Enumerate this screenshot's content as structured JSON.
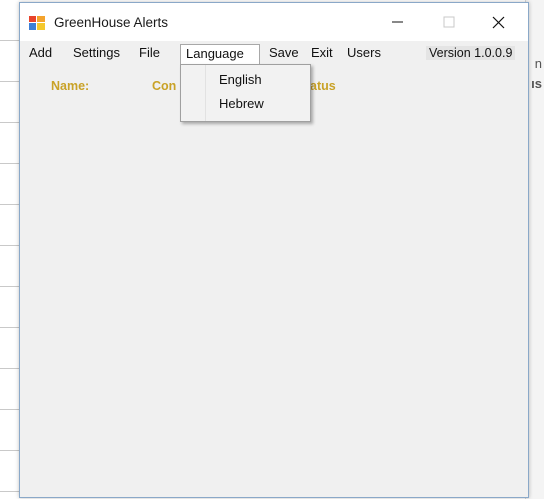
{
  "window": {
    "title": "GreenHouse Alerts"
  },
  "menu": {
    "items": [
      {
        "label": "Add"
      },
      {
        "label": "Settings"
      },
      {
        "label": "File"
      },
      {
        "label": "Language"
      },
      {
        "label": "Save"
      },
      {
        "label": "Exit"
      },
      {
        "label": "Users"
      }
    ],
    "version": "Version 1.0.0.9",
    "open_menu": "Language"
  },
  "language_menu": {
    "options": [
      {
        "label": "English"
      },
      {
        "label": "Hebrew"
      }
    ]
  },
  "header_labels": {
    "name": "Name:",
    "col2_partial": "Con",
    "col3_partial": "atus"
  },
  "colors": {
    "label_gold": "#c9a227",
    "window_bg": "#f0f0f0",
    "border_blue": "#8aa8c8"
  },
  "icons": [
    "app-icon",
    "minimize-icon",
    "maximize-icon",
    "close-icon"
  ]
}
